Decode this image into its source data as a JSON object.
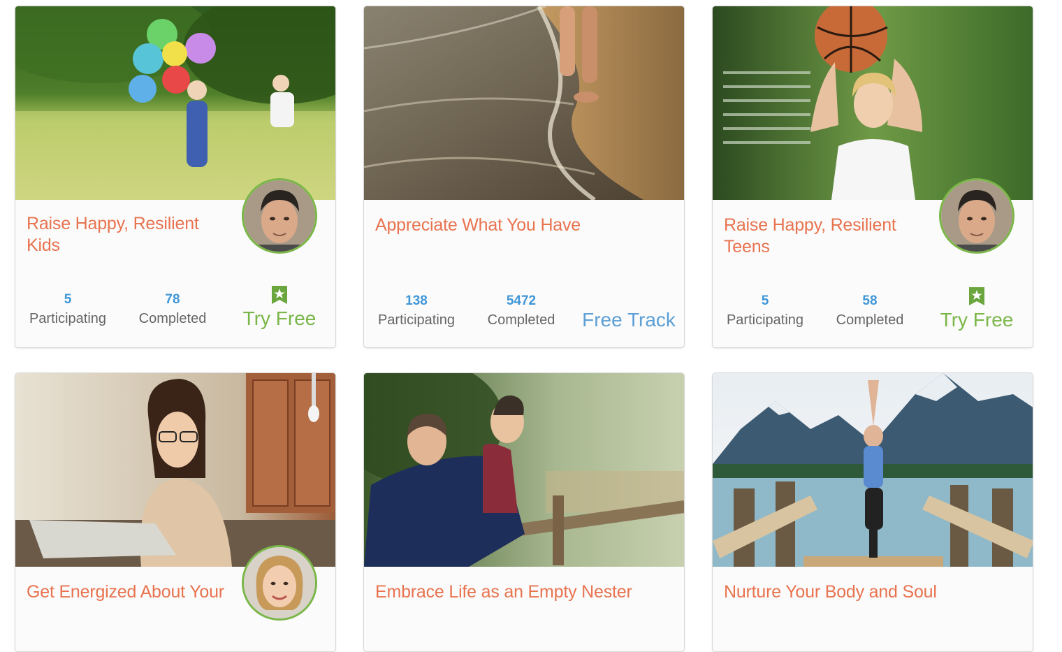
{
  "cards": [
    {
      "title": "Raise Happy, Resilient Kids",
      "photo": "kids-with-balloons-photo",
      "has_avatar": true,
      "avatar": "coach-male-avatar",
      "participating_count": "5",
      "participating_label": "Participating",
      "completed_count": "78",
      "completed_label": "Completed",
      "cta_label": "Try Free",
      "cta_style": "free"
    },
    {
      "title": "Appreciate What You Have",
      "photo": "beach-walk-photo",
      "has_avatar": false,
      "participating_count": "138",
      "participating_label": "Participating",
      "completed_count": "5472",
      "completed_label": "Completed",
      "cta_label": "Free Track",
      "cta_style": "track"
    },
    {
      "title": "Raise Happy, Resilient Teens",
      "photo": "teen-basketball-photo",
      "has_avatar": true,
      "avatar": "coach-male-avatar",
      "participating_count": "5",
      "participating_label": "Participating",
      "completed_count": "58",
      "completed_label": "Completed",
      "cta_label": "Try Free",
      "cta_style": "free"
    },
    {
      "title": "Get Energized About Your",
      "photo": "woman-reading-photo",
      "has_avatar": true,
      "avatar": "coach-female-avatar"
    },
    {
      "title": "Embrace Life as an Empty Nester",
      "photo": "couple-on-bridge-photo",
      "has_avatar": false
    },
    {
      "title": "Nurture Your Body and Soul",
      "photo": "yoga-by-lake-photo",
      "has_avatar": false
    }
  ],
  "colors": {
    "title": "#e8734f",
    "count": "#3f97d7",
    "try_free": "#7ab648",
    "free_track": "#5b9fd6",
    "avatar_ring": "#7ab648",
    "badge": "#6aa53d"
  },
  "icons": {
    "badge": "star-badge-icon"
  }
}
